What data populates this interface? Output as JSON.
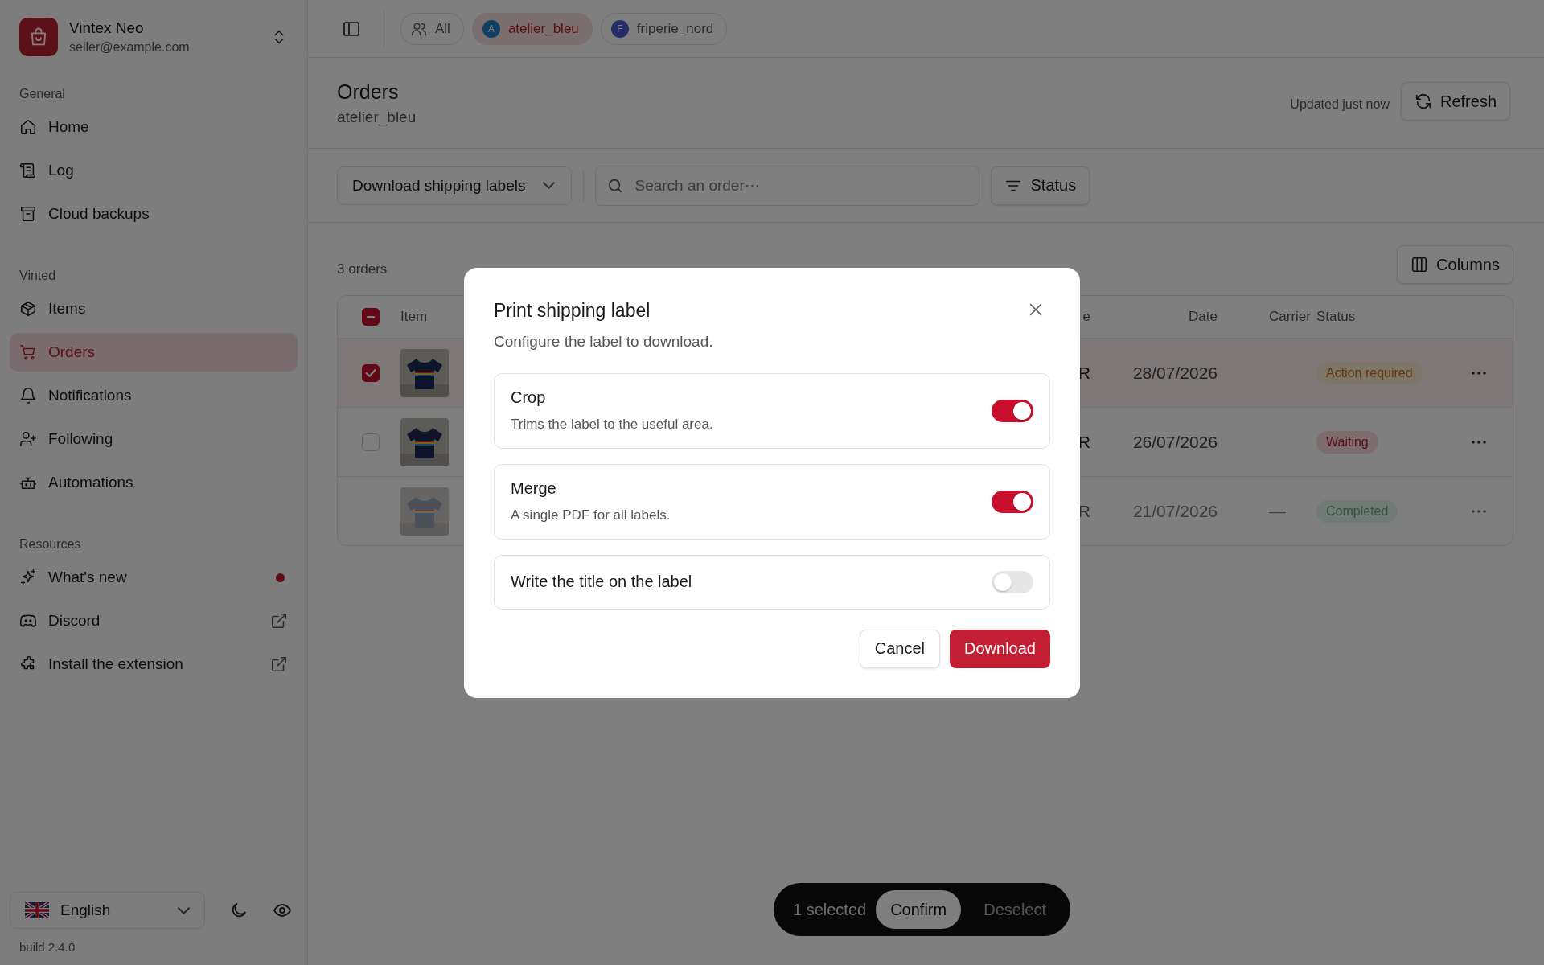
{
  "sidebar": {
    "account": {
      "name": "Vintex Neo",
      "email": "seller@example.com"
    },
    "sections": [
      {
        "title": "General",
        "items": [
          {
            "label": "Home",
            "selected": false
          },
          {
            "label": "Log",
            "selected": false
          },
          {
            "label": "Cloud backups",
            "selected": false
          }
        ]
      },
      {
        "title": "Vinted",
        "items": [
          {
            "label": "Items",
            "selected": false
          },
          {
            "label": "Orders",
            "selected": true
          },
          {
            "label": "Notifications",
            "selected": false
          },
          {
            "label": "Following",
            "selected": false
          },
          {
            "label": "Automations",
            "selected": false
          }
        ]
      },
      {
        "title": "Resources",
        "items": [
          {
            "label": "What's new",
            "selected": false,
            "badge": true
          },
          {
            "label": "Discord",
            "selected": false,
            "external": true
          },
          {
            "label": "Install the extension",
            "selected": false,
            "external": true
          }
        ]
      }
    ],
    "language": "English",
    "build": "build 2.4.0"
  },
  "topbar": {
    "accounts": [
      {
        "kind": "all",
        "label": "All",
        "selected": false
      },
      {
        "kind": "account",
        "label": "atelier_bleu",
        "initial": "A",
        "selected": true
      },
      {
        "kind": "account",
        "label": "friperie_nord",
        "initial": "F",
        "selected": false
      }
    ]
  },
  "header": {
    "title": "Orders",
    "subtitle": "atelier_bleu",
    "updated": "Updated just now",
    "refresh": "Refresh"
  },
  "toolbar": {
    "action": "Download shipping labels",
    "search": {
      "placeholder": "Search an order⋯"
    },
    "filter": "Status"
  },
  "orders": {
    "count": "3 orders",
    "columns_button": "Columns",
    "header_partial": true,
    "columns": [
      "Item",
      "e",
      "Date",
      "Carrier",
      "Status"
    ],
    "rows": [
      {
        "selected": true,
        "disabled": false,
        "price": "R",
        "date": "28/07/2026",
        "status": "Action required",
        "kind": "warning"
      },
      {
        "selected": false,
        "disabled": false,
        "price": "R",
        "date": "26/07/2026",
        "status": "Waiting",
        "kind": "danger"
      },
      {
        "selected": false,
        "disabled": true,
        "price": "R",
        "date": "21/07/2026",
        "carrier": "—",
        "status": "Completed",
        "kind": "success"
      }
    ]
  },
  "selection_bar": {
    "count": "1 selected",
    "confirm": "Confirm",
    "deselect": "Deselect"
  },
  "dialog": {
    "title": "Print shipping label",
    "description": "Configure the label to download.",
    "options": [
      {
        "label": "Crop",
        "description": "Trims the label to the useful area.",
        "on": true
      },
      {
        "label": "Merge",
        "description": "A single PDF for all labels.",
        "on": true
      },
      {
        "label": "Write the title on the label",
        "on": false
      }
    ],
    "cancel": "Cancel",
    "confirm": "Download"
  }
}
